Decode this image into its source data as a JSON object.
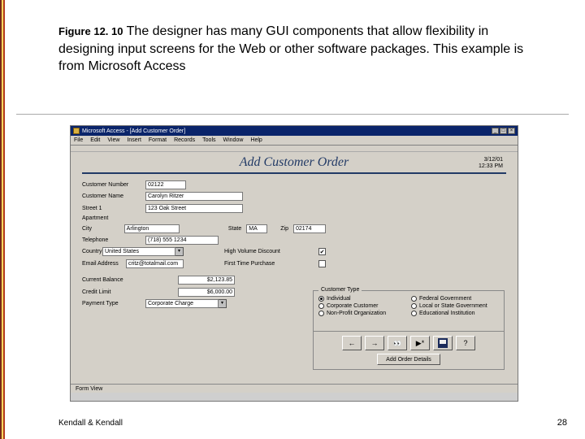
{
  "caption": {
    "figref": "Figure 12. 10",
    "text": " The designer has many GUI components that allow flexibility in designing input screens for the Web or other software packages. This example is from Microsoft Access"
  },
  "app": {
    "title": "Microsoft Access - [Add Customer Order]",
    "winbtns": [
      "_",
      "□",
      "×"
    ]
  },
  "menubar": [
    "File",
    "Edit",
    "View",
    "Insert",
    "Format",
    "Records",
    "Tools",
    "Window",
    "Help"
  ],
  "datebox": {
    "date": "3/12/01",
    "time": "12:33 PM"
  },
  "form": {
    "title": "Add Customer Order",
    "fields": {
      "custno_label": "Customer Number",
      "custno_val": "02122",
      "custname_label": "Customer Name",
      "custname_val": "Carolyn Ritzer",
      "street1_label": "Street 1",
      "street1_val": "123 Oak Street",
      "apt_label": "Apartment",
      "city_label": "City",
      "city_val": "Arlington",
      "state_label": "State",
      "state_val": "MA",
      "zip_label": "Zip",
      "zip_val": "02174",
      "tel_label": "Telephone",
      "tel_val": "(718) 555 1234",
      "country_label": "Country",
      "country_val": "United States",
      "email_label": "Email Address",
      "email_val": "critz@totalmail.com",
      "hvd_label": "High Volume Discount",
      "hvd_checked": "✔",
      "ftp_label": "First Time Purchase",
      "curbal_label": "Current Balance",
      "curbal_val": "$2,123.85",
      "credit_label": "Credit Limit",
      "credit_val": "$6,000.00",
      "paytype_label": "Payment Type",
      "paytype_val": "Corporate Charge"
    },
    "group": {
      "title": "Customer Type",
      "options": [
        "Individual",
        "Federal Government",
        "Corporate Customer",
        "Local or State Government",
        "Non-Profit Organization",
        "Educational Institution"
      ]
    },
    "addorder": "Add Order Details",
    "status": "Form View"
  },
  "footer": {
    "left": "Kendall & Kendall",
    "pageno": "28"
  }
}
